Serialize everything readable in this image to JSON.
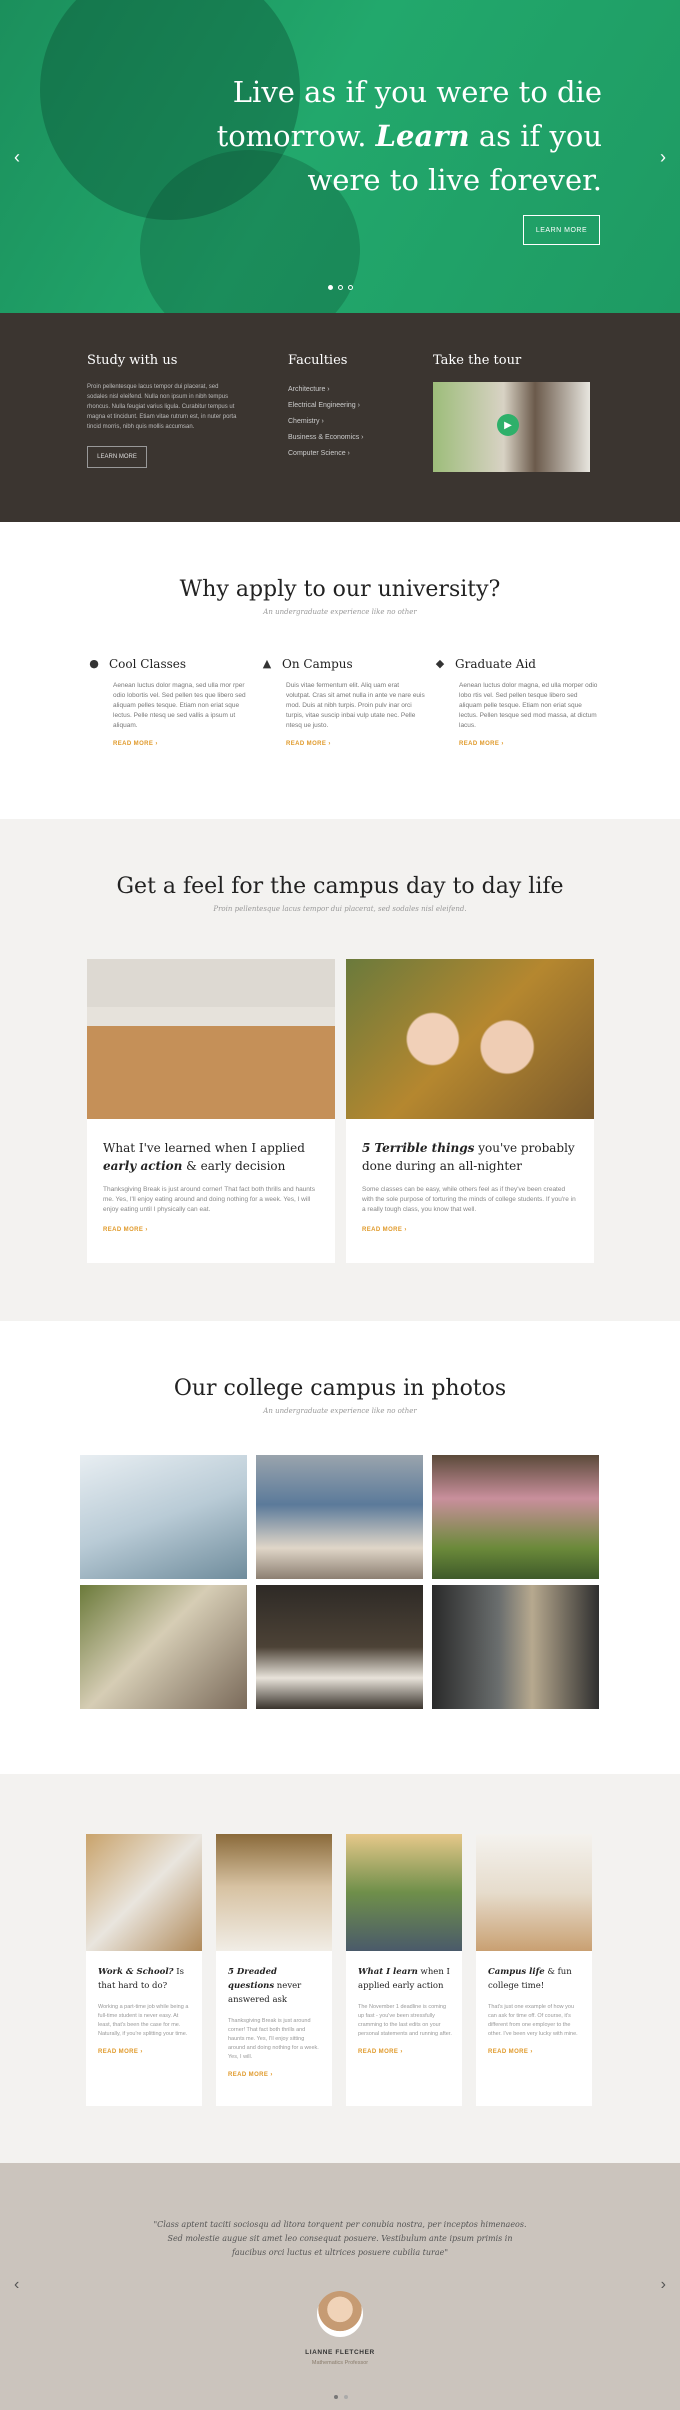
{
  "hero": {
    "title_line1": "Live as if you were to die",
    "title_pre": "tomorrow. ",
    "title_em": "Learn",
    "title_post": " as if you",
    "title_line3": "were to live forever.",
    "button": "LEARN MORE",
    "prev_icon": "chevron-left-icon",
    "next_icon": "chevron-right-icon"
  },
  "band": {
    "study": {
      "title": "Study with us",
      "text": "Proin pellentesque lacus tempor dui placerat, sed sodales nisl eleifend. Nulla non ipsum in nibh tempus rhoncus. Nulla feugiat varius ligula. Curabitur tempus ut magna et tincidunt. Etiam vitae rutrum est, in nuter porta tincid morris, nibh quis mollis accumsan.",
      "button": "LEARN MORE"
    },
    "faculties": {
      "title": "Faculties",
      "items": [
        "Architecture",
        "Electrical Engineering",
        "Chemistry",
        "Business & Economics",
        "Computer Science"
      ]
    },
    "tour": {
      "title": "Take the tour"
    }
  },
  "why": {
    "title": "Why apply to our university?",
    "subtitle": "An undergraduate experience like no other",
    "features": [
      {
        "title": "Cool Classes",
        "icon": "globe-icon",
        "text": "Aenean luctus dolor magna, sed ulla mor rper odio lobortis vel. Sed pellen tes que libero sed aliquam pelles tesque. Etiam non eriat sque lectus. Pelle ntesq ue sed vallis a ipsum ut aliquam.",
        "link": "READ MORE"
      },
      {
        "title": "On Campus",
        "icon": "building-icon",
        "text": "Duis vitae fermentum elit. Aliq uam erat volutpat. Cras sit amet nulla in ante ve nare euis mod. Duis at nibh turpis. Proin pulv inar orci turpis, vitae suscip inbai vulp utate nec. Pelle ntesq ue justo.",
        "link": "READ MORE"
      },
      {
        "title": "Graduate Aid",
        "icon": "graduation-cap-icon",
        "text": "Aenean luctus dolor magna, ed ulla morper odio lobo rtis vel. Sed pellen tesque libero sed aliquam pelle tesque. Etiam non eriat sque lectus. Pellen tesque sed mod massa, at dictum lacus.",
        "link": "READ MORE"
      }
    ]
  },
  "feel": {
    "title": "Get a feel for the campus day to day life",
    "subtitle": "Proin pellentesque lacus tempor dui placerat, sed sodales nisl eleifend.",
    "cards": [
      {
        "title_pre": "What I've learned when I applied ",
        "title_em": "early action",
        "title_post": " & early decision",
        "text": "Thanksgiving Break is just around corner! That fact both thrills and haunts me. Yes, I'll enjoy eating around and doing nothing for a week. Yes, I will enjoy eating until I physically can eat.",
        "link": "READ MORE"
      },
      {
        "title_pre": "",
        "title_em": "5 Terrible things",
        "title_post": " you've probably done during an all-nighter",
        "text": "Some classes can be easy, while others feel as if they've been created with the sole purpose of torturing the minds of college students. If you're in a really tough class, you know that well.",
        "link": "READ MORE"
      }
    ]
  },
  "photos": {
    "title": "Our college campus in photos",
    "subtitle": "An undergraduate experience like no other"
  },
  "blog": {
    "cards": [
      {
        "title_em": "Work & School?",
        "title_post": " Is that hard to do?",
        "text": "Working a part-time job while being a full-time student is never easy. At least, that's been the case for me. Naturally, if you're splitting your time.",
        "link": "READ MORE"
      },
      {
        "title_em": "5 Dreaded questions",
        "title_post": " never answered ask",
        "text": "Thanksgiving Break is just around corner! That fact both thrills and haunts me. Yes, I'll enjoy sitting around and doing nothing for a week. Yes, I will.",
        "link": "READ MORE"
      },
      {
        "title_em": "What I learn",
        "title_post": " when I applied early action",
        "text": "The November 1 deadline is coming up fast - you've been stressfully cramming to the last edits on your personal statements and running after.",
        "link": "READ MORE"
      },
      {
        "title_em": "Campus life",
        "title_post": " & fun college time!",
        "text": "That's just one example of how you can ask for time off. Of course, it's different from one employer to the other. I've been very lucky with mine.",
        "link": "READ MORE"
      }
    ]
  },
  "testimonial": {
    "quote": "\"Class aptent taciti sociosqu ad litora torquent per conubia nostra, per inceptos himenaeos. Sed molestie augue sit amet leo consequat posuere. Vestibulum ante ipsum primis in faucibus orci luctus et ultrices posuere cubilia turae\"",
    "name": "LIANNE FLETCHER",
    "role": "Mathematics Professor"
  },
  "colors": {
    "hero_green": "#22a86c",
    "band_dark": "#3b3530",
    "accent": "#e09a2b",
    "testimonial_bg": "#cbc4bd"
  }
}
